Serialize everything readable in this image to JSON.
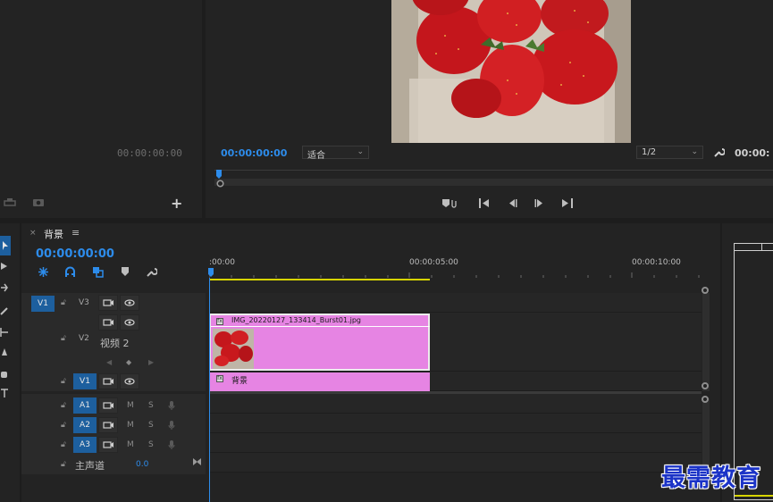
{
  "source_monitor": {
    "timecode": "00:00:00:00",
    "add_button": "+"
  },
  "program_monitor": {
    "timecode": "00:00:00:00",
    "fit_label": "适合",
    "resolution_label": "1/2",
    "end_timecode": "00:00:"
  },
  "timeline": {
    "sequence_name": "背景",
    "timecode": "00:00:00:00",
    "ruler": [
      ":00:00",
      "00:00:05:00",
      "00:00:10:00"
    ],
    "tracks": {
      "v1_source": "V1",
      "v3_label": "V3",
      "v2_label": "V2",
      "v2_name": "视频 2",
      "v1_label": "V1",
      "a1_label": "A1",
      "a2_label": "A2",
      "a3_label": "A3",
      "mute": "M",
      "solo": "S",
      "master_label": "主声道",
      "master_value": "0.0"
    },
    "clips": {
      "v2_clip_name": "IMG_20220127_133414_Burst01.jpg",
      "v1_clip_name": "背景",
      "fx_badge": "fx"
    }
  },
  "watermark": "最需教育",
  "colors": {
    "accent_blue": "#2d8ceb",
    "clip_pink": "#e684e3",
    "work_area_yellow": "#d7d400",
    "target_blue": "#1d5f9e"
  }
}
